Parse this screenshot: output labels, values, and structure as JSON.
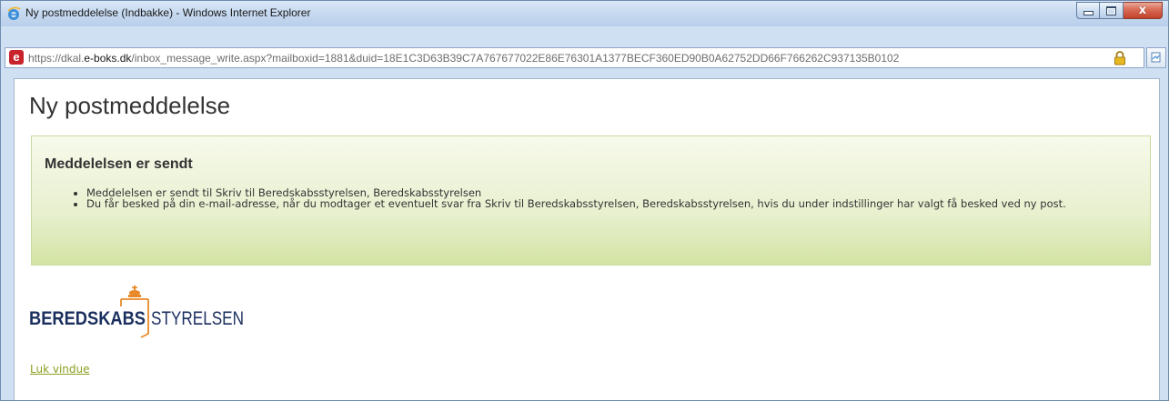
{
  "window": {
    "title": "Ny postmeddelelse (Indbakke) - Windows Internet Explorer",
    "controls": {
      "minimize": "minimize",
      "maximize": "maximize",
      "close_glyph": "x"
    }
  },
  "address_bar": {
    "url_scheme": "https://dkal.",
    "url_host": "e-boks.dk",
    "url_path": "/inbox_message_write.aspx?mailboxid=1881&duid=18E1C3D63B39C7A767677022E86E76301A1377BECF360ED90B0A62752DD66F766262C937135B0102",
    "site_icon": "e-boks-favicon",
    "lock_icon": "padlock-icon",
    "compat_icon": "compatibility-view-icon"
  },
  "page": {
    "title": "Ny postmeddelelse",
    "success": {
      "heading": "Meddelelsen er sendt",
      "items": [
        "Meddelelsen er sendt til Skriv til Beredskabsstyrelsen, Beredskabsstyrelsen",
        "Du får besked på din e-mail-adresse, når du modtager et eventuelt svar fra Skriv til Beredskabsstyrelsen, Beredskabsstyrelsen, hvis du under indstillinger har valgt få besked ved ny post."
      ]
    },
    "logo": {
      "left_word": "BEREDSKABS",
      "right_word": "STYRELSEN"
    },
    "close_link": "Luk vindue"
  },
  "colors": {
    "success_bg_top": "#f7faeb",
    "success_bg_bottom": "#d3e3a4",
    "link": "#8aa01f",
    "logo_navy": "#1b2f5e",
    "logo_orange": "#e98a2a",
    "close_red": "#c2422b"
  }
}
